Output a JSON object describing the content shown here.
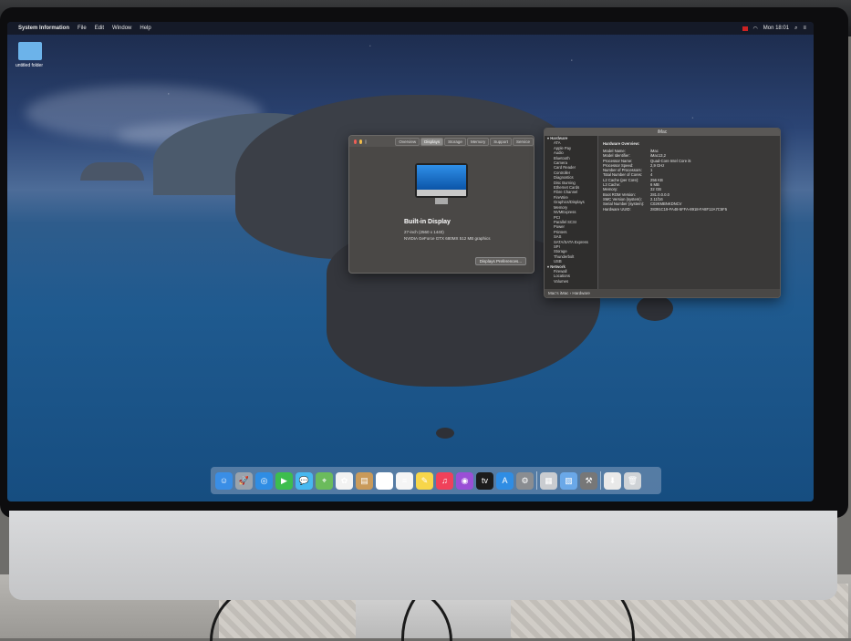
{
  "menubar": {
    "app_name": "System Information",
    "menus": [
      "File",
      "Edit",
      "Window",
      "Help"
    ],
    "clock": "Mon 18:01"
  },
  "desktop": {
    "folder_label": "untitled folder"
  },
  "about_window": {
    "tabs": [
      "Overview",
      "Displays",
      "Storage",
      "Memory",
      "Support",
      "Service"
    ],
    "active_tab": "Displays",
    "title": "Built-in Display",
    "resolution": "27-inch (2560 x 1440)",
    "graphics": "NVIDIA GeForce GTX 680MX 512 MB graphics",
    "button_label": "Displays Preferences..."
  },
  "sysinfo_window": {
    "title": "iMac",
    "sidebar": [
      {
        "label": "Hardware",
        "section": true
      },
      {
        "label": "ATA"
      },
      {
        "label": "Apple Pay"
      },
      {
        "label": "Audio"
      },
      {
        "label": "Bluetooth"
      },
      {
        "label": "Camera"
      },
      {
        "label": "Card Reader"
      },
      {
        "label": "Controller"
      },
      {
        "label": "Diagnostics"
      },
      {
        "label": "Disc Burning"
      },
      {
        "label": "Ethernet Cards"
      },
      {
        "label": "Fibre Channel"
      },
      {
        "label": "FireWire"
      },
      {
        "label": "Graphics/Displays"
      },
      {
        "label": "Memory"
      },
      {
        "label": "NVMExpress"
      },
      {
        "label": "PCI"
      },
      {
        "label": "Parallel SCSI"
      },
      {
        "label": "Power"
      },
      {
        "label": "Printers"
      },
      {
        "label": "SAS"
      },
      {
        "label": "SATA/SATA Express"
      },
      {
        "label": "SPI"
      },
      {
        "label": "Storage"
      },
      {
        "label": "Thunderbolt"
      },
      {
        "label": "USB"
      },
      {
        "label": "Network",
        "section": true
      },
      {
        "label": "Firewall"
      },
      {
        "label": "Locations"
      },
      {
        "label": "Volumes"
      }
    ],
    "heading": "Hardware Overview:",
    "details": [
      {
        "k": "Model Name:",
        "v": "iMac"
      },
      {
        "k": "Model Identifier:",
        "v": "iMac13,2"
      },
      {
        "k": "Processor Name:",
        "v": "Quad-Core Intel Core i5"
      },
      {
        "k": "Processor Speed:",
        "v": "2,9 GHz"
      },
      {
        "k": "Number of Processors:",
        "v": "1"
      },
      {
        "k": "Total Number of Cores:",
        "v": "4"
      },
      {
        "k": "L2 Cache (per Core):",
        "v": "256 KB"
      },
      {
        "k": "L3 Cache:",
        "v": "6 MB"
      },
      {
        "k": "Memory:",
        "v": "32 GB"
      },
      {
        "k": "Boot ROM Version:",
        "v": "281.0.0.0.0"
      },
      {
        "k": "SMC Version (system):",
        "v": "2.11f16"
      },
      {
        "k": "Serial Number (system):",
        "v": "C02KMBNKDNCV"
      },
      {
        "k": "Hardware UUID:",
        "v": "28391C19-FA48-5FFA-8918-FA8F12A7C5F5"
      }
    ],
    "breadcrumb": "Mac's iMac › Hardware"
  },
  "dock": {
    "icons": [
      {
        "name": "finder-icon",
        "color": "#3a8ee6",
        "glyph": "☺"
      },
      {
        "name": "launchpad-icon",
        "color": "#9aa3ad",
        "glyph": "🚀"
      },
      {
        "name": "safari-icon",
        "color": "#2f8de4",
        "glyph": "◎"
      },
      {
        "name": "facetime-icon",
        "color": "#3dbd4e",
        "glyph": "▶"
      },
      {
        "name": "messages-icon",
        "color": "#47b8f0",
        "glyph": "💬"
      },
      {
        "name": "maps-icon",
        "color": "#6bbb5c",
        "glyph": "⌖"
      },
      {
        "name": "photos-icon",
        "color": "#f2f2f2",
        "glyph": "✿"
      },
      {
        "name": "contacts-icon",
        "color": "#c99a5a",
        "glyph": "▤"
      },
      {
        "name": "calendar-icon",
        "color": "#ffffff",
        "glyph": "27"
      },
      {
        "name": "reminders-icon",
        "color": "#f5f5f5",
        "glyph": "≡"
      },
      {
        "name": "notes-icon",
        "color": "#f7d64a",
        "glyph": "✎"
      },
      {
        "name": "music-icon",
        "color": "#f0415a",
        "glyph": "♫"
      },
      {
        "name": "podcasts-icon",
        "color": "#9a4fd6",
        "glyph": "◉"
      },
      {
        "name": "tv-icon",
        "color": "#1c1c1c",
        "glyph": "tv"
      },
      {
        "name": "app-store-icon",
        "color": "#2f8de4",
        "glyph": "A"
      },
      {
        "name": "system-preferences-icon",
        "color": "#8a8d91",
        "glyph": "⚙"
      },
      {
        "name": "sep"
      },
      {
        "name": "system-information-icon",
        "color": "#c9ccd0",
        "glyph": "▦"
      },
      {
        "name": "preview-icon",
        "color": "#6aa8e8",
        "glyph": "▨"
      },
      {
        "name": "tools-icon",
        "color": "#777",
        "glyph": "⚒"
      },
      {
        "name": "sep"
      },
      {
        "name": "downloads-icon",
        "color": "#e9e9e9",
        "glyph": "⬇"
      },
      {
        "name": "trash-icon",
        "color": "#cfd3d7",
        "glyph": "🗑"
      }
    ]
  }
}
